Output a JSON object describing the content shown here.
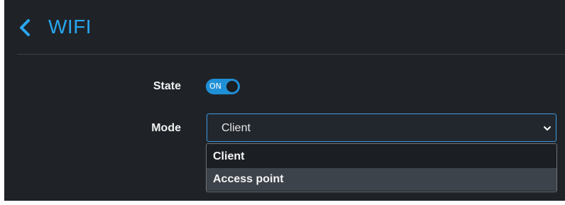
{
  "header": {
    "back_icon": "chevron-left-icon",
    "title": "WIFI"
  },
  "form": {
    "state": {
      "label": "State",
      "toggle_text": "ON",
      "checked": true
    },
    "mode": {
      "label": "Mode",
      "value": "Client",
      "chevron_icon": "chevron-down-icon",
      "options": [
        "Client",
        "Access point"
      ],
      "highlighted_option": "Access point"
    }
  },
  "colors": {
    "accent": "#29a6f0",
    "toggle_on": "#1f8fd6",
    "background": "#1f2328",
    "option_hover": "#3d434a"
  }
}
